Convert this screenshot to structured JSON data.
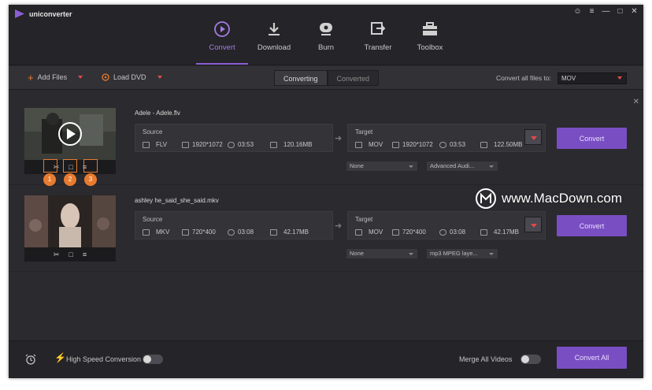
{
  "app": {
    "name": "uniconverter"
  },
  "window_controls": [
    "user-icon",
    "menu-icon",
    "minimize-icon",
    "maximize-icon",
    "close-icon"
  ],
  "nav_tabs": [
    {
      "label": "Convert",
      "icon": "convert-icon",
      "active": true
    },
    {
      "label": "Download",
      "icon": "download-icon"
    },
    {
      "label": "Burn",
      "icon": "burn-icon"
    },
    {
      "label": "Transfer",
      "icon": "transfer-icon"
    },
    {
      "label": "Toolbox",
      "icon": "toolbox-icon"
    }
  ],
  "toolbar": {
    "add_files": "Add Files",
    "load_dvd": "Load DVD",
    "seg_converting": "Converting",
    "seg_converted": "Converted",
    "convert_all_label": "Convert all files to:",
    "convert_all_value": "MOV"
  },
  "files": [
    {
      "name": "Adele - Adele.flv",
      "source": {
        "label": "Source",
        "format": "FLV",
        "resolution": "1920*1072",
        "duration": "03:53",
        "size": "120.16MB"
      },
      "target": {
        "label": "Target",
        "format": "MOV",
        "resolution": "1920*1072",
        "duration": "03:53",
        "size": "122.50MB"
      },
      "subtitle": "None",
      "audio": "Advanced Audi...",
      "convert_label": "Convert",
      "badges": [
        "1",
        "2",
        "3"
      ]
    },
    {
      "name": "ashley he_said_she_said.mkv",
      "source": {
        "label": "Source",
        "format": "MKV",
        "resolution": "720*400",
        "duration": "03:08",
        "size": "42.17MB"
      },
      "target": {
        "label": "Target",
        "format": "MOV",
        "resolution": "720*400",
        "duration": "03:08",
        "size": "42.17MB"
      },
      "subtitle": "None",
      "audio": "mp3 MPEG laye...",
      "convert_label": "Convert"
    }
  ],
  "bottom": {
    "high_speed": "High Speed Conversion",
    "merge": "Merge All Videos",
    "convert_all": "Convert All"
  },
  "watermark": "www.MacDown.com",
  "colors": {
    "accent": "#7a4ec3",
    "active_tab": "#a57be6",
    "orange": "#e87b2f",
    "arrow_red": "#e04a4a"
  }
}
